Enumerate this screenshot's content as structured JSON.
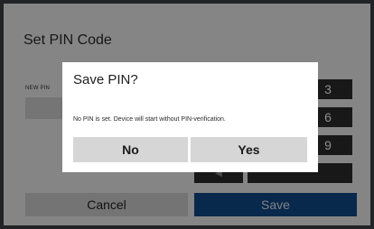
{
  "screen": {
    "title": "Set PIN Code",
    "pin_label": "NEW PIN",
    "pin_value": ""
  },
  "keypad": {
    "keys": [
      "3",
      "6",
      "9"
    ],
    "back_icon": "arrow-left-icon"
  },
  "actions": {
    "cancel_label": "Cancel",
    "save_label": "Save"
  },
  "dialog": {
    "title": "Save PIN?",
    "message": "No PIN is set. Device will start without PIN-verification.",
    "no_label": "No",
    "yes_label": "Yes"
  },
  "colors": {
    "save_button": "#0f4a8a",
    "keypad": "#2d2d2d",
    "overlay": "rgba(0,0,0,0.45)"
  }
}
